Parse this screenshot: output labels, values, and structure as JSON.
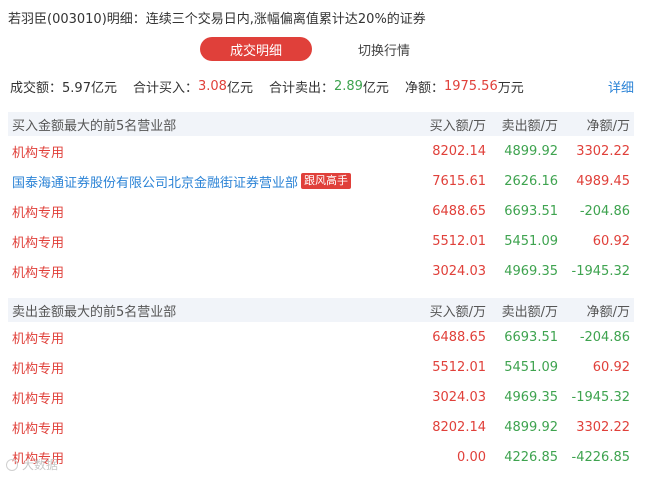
{
  "title": "若羽臣(003010)明细：连续三个交易日内,涨幅偏离值累计达20%的证券",
  "tabs": {
    "active": "成交明细",
    "inactive": "切换行情"
  },
  "summary": {
    "turnover_label": "成交额：",
    "turnover_value": "5.97亿元",
    "buy_label": "合计买入：",
    "buy_value": "3.08",
    "buy_unit": "亿元",
    "sell_label": "合计卖出：",
    "sell_value": "2.89",
    "sell_unit": "亿元",
    "net_label": "净额：",
    "net_value": "1975.56",
    "net_unit": "万元",
    "detail_link": "详细"
  },
  "buy_table": {
    "header": {
      "name": "买入金额最大的前5名营业部",
      "buy": "买入额/万",
      "sell": "卖出额/万",
      "net": "净额/万"
    },
    "rows": [
      {
        "name": "机构专用",
        "badge": "",
        "buy": "8202.14",
        "sell": "4899.92",
        "net": "3302.22"
      },
      {
        "name": "国泰海通证券股份有限公司北京金融街证券营业部",
        "badge": "跟风高手",
        "buy": "7615.61",
        "sell": "2626.16",
        "net": "4989.45"
      },
      {
        "name": "机构专用",
        "badge": "",
        "buy": "6488.65",
        "sell": "6693.51",
        "net": "-204.86"
      },
      {
        "name": "机构专用",
        "badge": "",
        "buy": "5512.01",
        "sell": "5451.09",
        "net": "60.92"
      },
      {
        "name": "机构专用",
        "badge": "",
        "buy": "3024.03",
        "sell": "4969.35",
        "net": "-1945.32"
      }
    ]
  },
  "sell_table": {
    "header": {
      "name": "卖出金额最大的前5名营业部",
      "buy": "买入额/万",
      "sell": "卖出额/万",
      "net": "净额/万"
    },
    "rows": [
      {
        "name": "机构专用",
        "buy": "6488.65",
        "sell": "6693.51",
        "net": "-204.86"
      },
      {
        "name": "机构专用",
        "buy": "5512.01",
        "sell": "5451.09",
        "net": "60.92"
      },
      {
        "name": "机构专用",
        "buy": "3024.03",
        "sell": "4969.35",
        "net": "-1945.32"
      },
      {
        "name": "机构专用",
        "buy": "8202.14",
        "sell": "4899.92",
        "net": "3302.22"
      },
      {
        "name": "机构专用",
        "buy": "0.00",
        "sell": "4226.85",
        "net": "-4226.85"
      }
    ]
  },
  "watermark": "大数据",
  "colors": {
    "accent_red": "#e0403a",
    "green": "#3ea34f",
    "link_blue": "#2b83d6",
    "header_bg": "#f1f4f9"
  }
}
